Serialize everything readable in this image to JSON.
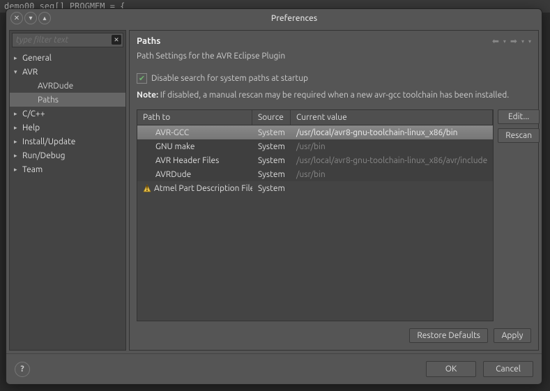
{
  "backdrop": {
    "text": "demo00_seg[] PROGMEM = {"
  },
  "dialog": {
    "title": "Preferences",
    "filter_placeholder": "type filter text"
  },
  "tree": {
    "items": [
      {
        "label": "General",
        "state": "collapsed",
        "level": 1
      },
      {
        "label": "AVR",
        "state": "expanded",
        "level": 1
      },
      {
        "label": "AVRDude",
        "state": "leaf",
        "level": 2
      },
      {
        "label": "Paths",
        "state": "leaf",
        "level": 2,
        "selected": true
      },
      {
        "label": "C/C++",
        "state": "collapsed",
        "level": 1
      },
      {
        "label": "Help",
        "state": "collapsed",
        "level": 1
      },
      {
        "label": "Install/Update",
        "state": "collapsed",
        "level": 1
      },
      {
        "label": "Run/Debug",
        "state": "collapsed",
        "level": 1
      },
      {
        "label": "Team",
        "state": "collapsed",
        "level": 1
      }
    ]
  },
  "page": {
    "title": "Paths",
    "subtitle": "Path Settings for the AVR Eclipse Plugin",
    "checkbox_label": "Disable search for system paths at startup",
    "checkbox_checked": true,
    "note_label": "Note:",
    "note_text": "If disabled, a manual rescan may be required when a new avr-gcc toolchain has been installed."
  },
  "table": {
    "headers": {
      "c1": "Path to",
      "c2": "Source",
      "c3": "Current value"
    },
    "rows": [
      {
        "name": "AVR-GCC",
        "source": "System",
        "value": "/usr/local/avr8-gnu-toolchain-linux_x86/bin",
        "selected": true
      },
      {
        "name": "GNU make",
        "source": "System",
        "value": "/usr/bin"
      },
      {
        "name": "AVR Header Files",
        "source": "System",
        "value": "/usr/local/avr8-gnu-toolchain-linux_x86/avr/include"
      },
      {
        "name": "AVRDude",
        "source": "System",
        "value": "/usr/bin"
      },
      {
        "name": "Atmel Part Description Files",
        "source": "System",
        "value": "",
        "warn": true
      }
    ]
  },
  "buttons": {
    "edit": "Edit...",
    "rescan": "Rescan",
    "restore": "Restore Defaults",
    "apply": "Apply",
    "ok": "OK",
    "cancel": "Cancel"
  }
}
